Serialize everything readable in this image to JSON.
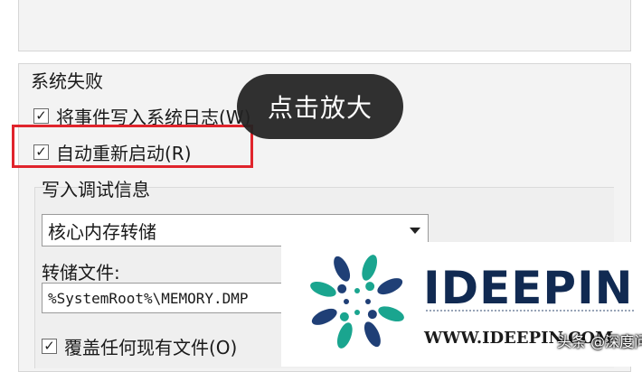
{
  "group_title": "系统失败",
  "checkboxes": {
    "write_event": {
      "label": "将事件写入系统日志(W)",
      "checked": true
    },
    "auto_restart": {
      "label": "自动重新启动(R)",
      "checked": true
    },
    "overwrite": {
      "label": "覆盖任何现有文件(O)",
      "checked": true
    }
  },
  "check_glyph": "☑",
  "tooltip": "点击放大",
  "debug_section": {
    "title": "写入调试信息",
    "dropdown_value": "核心内存转储",
    "dump_file_label": "转储文件:",
    "dump_file_value": "%SystemRoot%\\MEMORY.DMP"
  },
  "watermark": {
    "brand": "IDEEPIN",
    "site": "WWW.IDEEPIN.COM",
    "credit": "头条 @深度问答"
  },
  "colors": {
    "highlight": "#e0242c",
    "brand": "#112a52",
    "logo_teal": "#1aa58f",
    "logo_navy": "#1f3f76"
  }
}
